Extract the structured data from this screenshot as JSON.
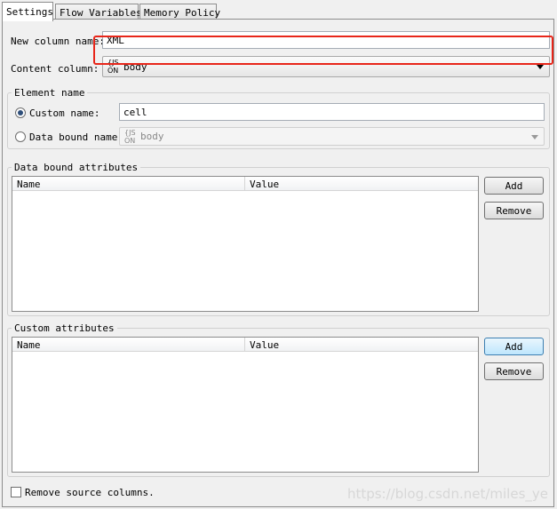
{
  "tabs": [
    {
      "label": "Settings",
      "active": true
    },
    {
      "label": "Flow Variables",
      "active": false
    },
    {
      "label": "Memory Policy",
      "active": false
    }
  ],
  "new_column": {
    "label": "New column name:",
    "value": "XML"
  },
  "content_column": {
    "label": "Content column:",
    "type_icon_top": "{JS",
    "type_icon_bottom": "ON",
    "value": "body"
  },
  "element_name": {
    "title": "Element name",
    "custom_name": {
      "label": "Custom name:",
      "selected": true,
      "value": "cell"
    },
    "data_bound_name": {
      "label": "Data bound name:",
      "selected": false,
      "type_icon_top": "{JS",
      "type_icon_bottom": "ON",
      "value": "body"
    }
  },
  "data_bound_attributes": {
    "title": "Data bound attributes",
    "columns": [
      "Name",
      "Value"
    ],
    "rows": [],
    "add_label": "Add",
    "remove_label": "Remove"
  },
  "custom_attributes": {
    "title": "Custom attributes",
    "columns": [
      "Name",
      "Value"
    ],
    "rows": [],
    "add_label": "Add",
    "remove_label": "Remove"
  },
  "remove_source": {
    "label": "Remove source columns.",
    "checked": false
  },
  "watermark": "https://blog.csdn.net/miles_ye",
  "colors": {
    "highlight": "#e8261a",
    "radio_selected": "#2f4f7a",
    "button_hover": "#bee6fd"
  }
}
